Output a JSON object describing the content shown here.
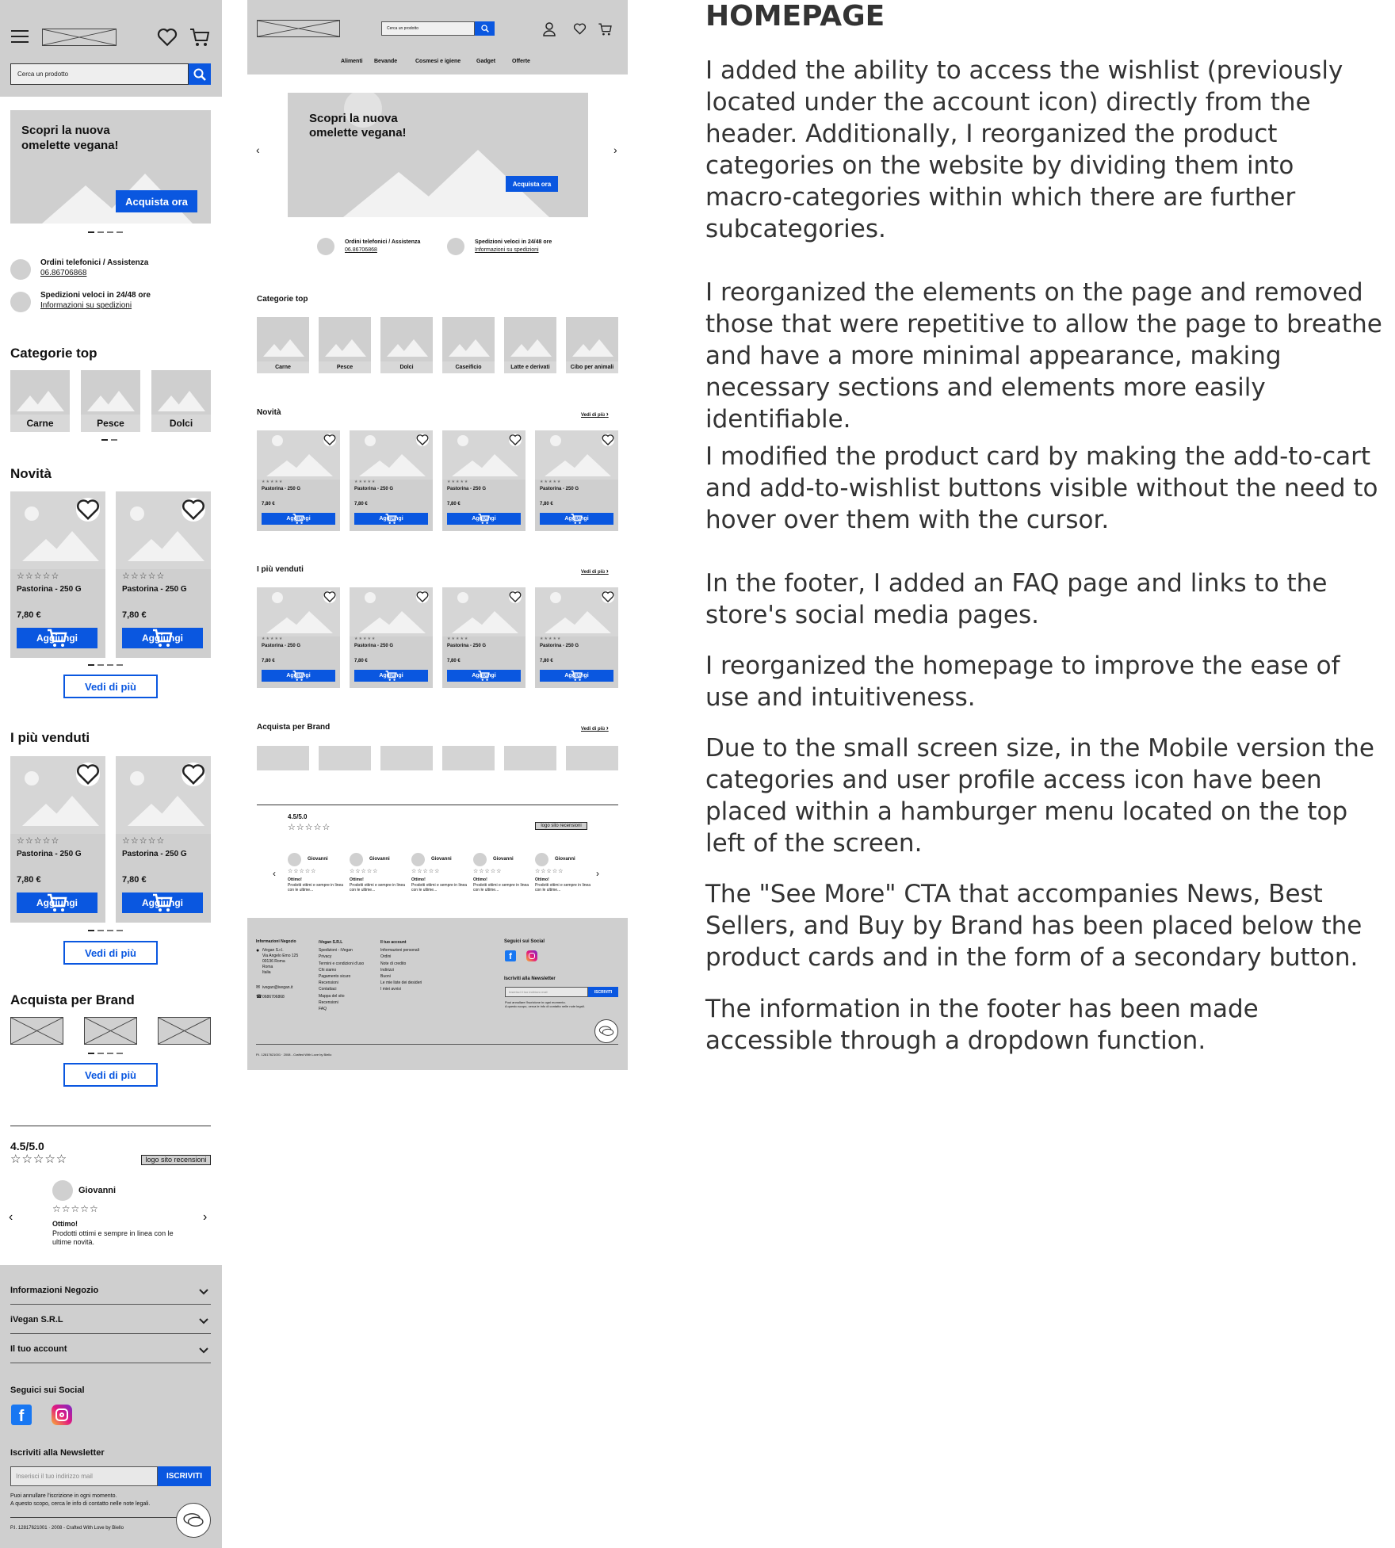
{
  "mobile": {
    "search_placeholder": "Cerca un prodotto",
    "hero": {
      "title": "Scopri la nuova omelette vegana!",
      "cta": "Acquista ora"
    },
    "info": [
      {
        "title": "Ordini telefonici / Assistenza",
        "link": "06.86706868"
      },
      {
        "title": "Spedizioni veloci in 24/48 ore",
        "link": "Informazioni su spedizioni"
      }
    ],
    "categorie_title": "Categorie top",
    "categories": [
      "Carne",
      "Pesce",
      "Dolci"
    ],
    "novita_title": "Novità",
    "piu_venduti_title": "I più venduti",
    "product": {
      "stars": "☆☆☆☆☆",
      "name": "Pastorina - 250 G",
      "price": "7,80 €",
      "add": "Aggiungi"
    },
    "see_more": "Vedi di più",
    "brand_title": "Acquista per Brand",
    "reviews": {
      "score": "4.5/5.0",
      "stars": "☆☆☆☆☆",
      "logo": "logo sito recensioni",
      "reviewer": "Giovanni",
      "review_title": "Ottimo!",
      "review_text": "Prodotti ottimi e sempre in linea con le ultime novità."
    },
    "footer": {
      "accordions": [
        "Informazioni Negozio",
        "iVegan S.R.L",
        "Il tuo account"
      ],
      "social_title": "Seguici sui Social",
      "newsletter_title": "Iscriviti alla Newsletter",
      "newsletter_placeholder": "Inserisci il tuo indirizzo mail",
      "newsletter_btn": "ISCRIVITI",
      "newsletter_note1": "Puoi annullare l'iscrizione in ogni momento.",
      "newsletter_note2": "A questo scopo, cerca le info di contatto nelle note legali.",
      "copyright": "P.I. 12817621001 · 2008 - Crafted With Love by Biello"
    }
  },
  "desktop": {
    "search_placeholder": "Cerca un prodotto",
    "nav": [
      "Alimenti",
      "Bevande",
      "Cosmesi e igiene",
      "Gadget",
      "Offerte"
    ],
    "hero": {
      "title": "Scopri la nuova omelette vegana!",
      "cta": "Acquista ora"
    },
    "info": [
      {
        "title": "Ordini telefonici / Assistenza",
        "link": "06.86706868"
      },
      {
        "title": "Spedizioni veloci in 24/48 ore",
        "link": "Informazioni su spedizioni"
      }
    ],
    "categorie_title": "Categorie top",
    "categories": [
      "Carne",
      "Pesce",
      "Dolci",
      "Caseificio",
      "Latte e derivati",
      "Cibo per animali"
    ],
    "novita_title": "Novità",
    "piu_venduti_title": "I più venduti",
    "brand_title": "Acquista per Brand",
    "see_more": "Vedi di più",
    "product": {
      "stars": "★★★★★",
      "name": "Pastorina - 250 G",
      "price": "7,80 €",
      "add": "Aggiungi"
    },
    "reviews": {
      "score": "4.5/5.0",
      "stars": "☆☆☆☆☆",
      "logo": "logo sito recensioni",
      "reviewer": "Giovanni",
      "review_title": "Ottimo!",
      "review_text": "Prodotti ottimi e sempre in linea con le ultime..."
    },
    "footer": {
      "col1_title": "Informazioni Negozio",
      "col1_lines": [
        "iVegan S.r.l.",
        "Via Angelo Emo 125",
        "00136 Roma",
        "Roma",
        "Italia"
      ],
      "email": "ivegan@ivegan.it",
      "phone": "0686706868",
      "col2_title": "iVegan S.R.L",
      "col2_links": [
        "Spedizioni - iVegan",
        "Privacy",
        "Termini e condizioni d'uso",
        "Chi siamo",
        "Pagamento sicuro",
        "Recensioni",
        "Contattaci",
        "Mappa del sito",
        "Recensioni",
        "FAQ"
      ],
      "col3_title": "Il tuo account",
      "col3_links": [
        "Informazioni personali",
        "Ordini",
        "Note di credito",
        "Indirizzi",
        "Buoni",
        "Le mie liste dei desideri",
        "I miei avvisi"
      ],
      "social_title": "Seguici sui Social",
      "newsletter_title": "Iscriviti alla Newsletter",
      "newsletter_placeholder": "Inserisci il tuo indirizzo mail",
      "newsletter_btn": "ISCRIVITI",
      "newsletter_note1": "Puoi annullare l'iscrizione in ogni momento.",
      "newsletter_note2": "A questo scopo, cerca le info di contatto nelle note legali.",
      "copyright": "P.I. 12817621001 · 2008 - Crafted With Love by Biello"
    }
  },
  "notes": {
    "heading": "HOMEPAGE",
    "paragraphs": [
      "I added the ability to access the wishlist (previously located under the account icon) directly from the header. Additionally, I reorganized the product categories on the website by dividing them into macro-categories within which there are further subcategories.",
      "I reorganized the elements on the page and removed those that were repetitive to allow the page to breathe and have a more minimal appearance, making necessary sections and elements more easily identifiable.",
      "I modified the product card by making the add-to-cart and add-to-wishlist buttons visible without the need to hover over them with the cursor.",
      "In the footer, I added an FAQ page and links to the store's social media pages.",
      "I reorganized the homepage to improve the ease of use and intuitiveness.",
      "Due to the small screen size, in the Mobile version the categories and user profile access icon have been placed within a hamburger menu located on the top left of the screen.",
      "The \"See More\" CTA that accompanies News, Best Sellers, and Buy by Brand has been placed below the product cards and in the form of a secondary button.",
      "The information in the footer has been made accessible through a dropdown function."
    ]
  },
  "colors": {
    "accent": "#0a57e0",
    "wireframe_grey": "#cfcfcf"
  }
}
